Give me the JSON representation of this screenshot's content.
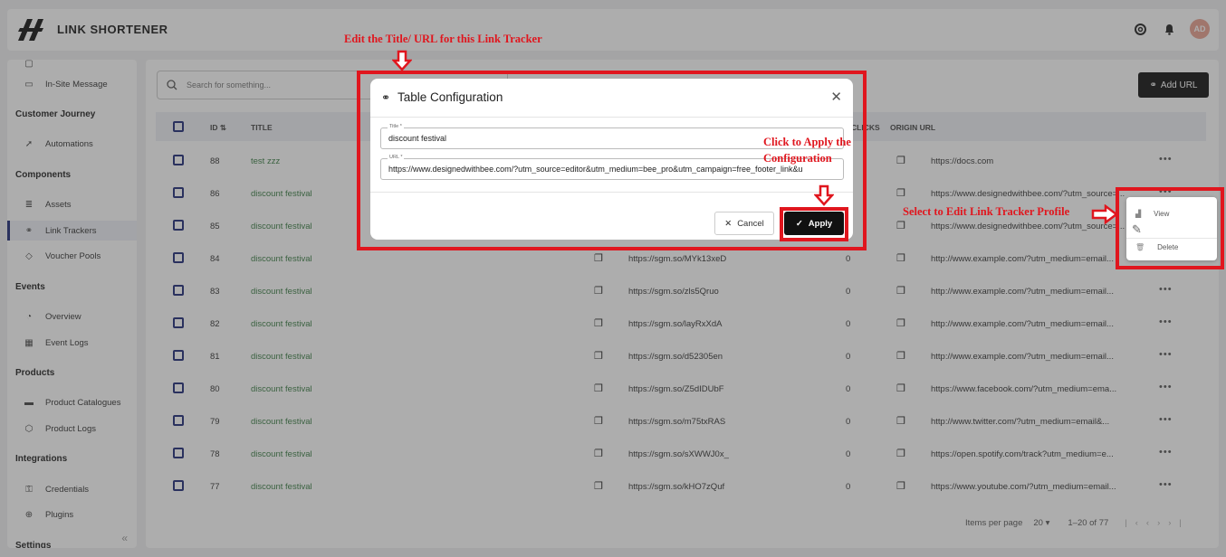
{
  "app": {
    "title": "LINK SHORTENER",
    "avatar": "AD"
  },
  "sidebar": {
    "items": [
      {
        "label": "In-Site Message",
        "icon": "message-icon"
      },
      {
        "section": "Customer Journey"
      },
      {
        "label": "Automations",
        "icon": "rocket-icon"
      },
      {
        "section": "Components"
      },
      {
        "label": "Assets",
        "icon": "database-icon"
      },
      {
        "label": "Link Trackers",
        "icon": "link-icon",
        "active": true
      },
      {
        "label": "Voucher Pools",
        "icon": "tag-icon"
      },
      {
        "section": "Events"
      },
      {
        "label": "Overview",
        "icon": "overview-icon"
      },
      {
        "label": "Event Logs",
        "icon": "calendar-icon"
      },
      {
        "section": "Products"
      },
      {
        "label": "Product Catalogues",
        "icon": "catalogue-icon"
      },
      {
        "label": "Product Logs",
        "icon": "cube-icon"
      },
      {
        "section": "Integrations"
      },
      {
        "label": "Credentials",
        "icon": "key-icon"
      },
      {
        "label": "Plugins",
        "icon": "plugin-icon"
      },
      {
        "section": "Settings"
      }
    ]
  },
  "toolbar": {
    "search_placeholder": "Search for something...",
    "add_label": "Add URL"
  },
  "table": {
    "headers": {
      "id": "ID",
      "title": "TITLE",
      "clicks": "CLICKS",
      "origin": "ORIGIN URL"
    },
    "rows": [
      {
        "id": "88",
        "title": "test zzz",
        "short": "",
        "clicks": "",
        "origin": "https://docs.com"
      },
      {
        "id": "86",
        "title": "discount festival",
        "short": "",
        "clicks": "",
        "origin": "https://www.designedwithbee.com/?utm_source=..."
      },
      {
        "id": "85",
        "title": "discount festival",
        "short": "",
        "clicks": "",
        "origin": "https://www.designedwithbee.com/?utm_source=..."
      },
      {
        "id": "84",
        "title": "discount festival",
        "short": "https://sgm.so/MYk13xeD",
        "clicks": "0",
        "origin": "http://www.example.com/?utm_medium=email..."
      },
      {
        "id": "83",
        "title": "discount festival",
        "short": "https://sgm.so/zls5Qruo",
        "clicks": "0",
        "origin": "http://www.example.com/?utm_medium=email..."
      },
      {
        "id": "82",
        "title": "discount festival",
        "short": "https://sgm.so/layRxXdA",
        "clicks": "0",
        "origin": "http://www.example.com/?utm_medium=email..."
      },
      {
        "id": "81",
        "title": "discount festival",
        "short": "https://sgm.so/d52305en",
        "clicks": "0",
        "origin": "http://www.example.com/?utm_medium=email..."
      },
      {
        "id": "80",
        "title": "discount festival",
        "short": "https://sgm.so/Z5dIDUbF",
        "clicks": "0",
        "origin": "https://www.facebook.com/?utm_medium=ema..."
      },
      {
        "id": "79",
        "title": "discount festival",
        "short": "https://sgm.so/m75txRAS",
        "clicks": "0",
        "origin": "http://www.twitter.com/?utm_medium=email&..."
      },
      {
        "id": "78",
        "title": "discount festival",
        "short": "https://sgm.so/sXWWJ0x_",
        "clicks": "0",
        "origin": "https://open.spotify.com/track?utm_medium=e..."
      },
      {
        "id": "77",
        "title": "discount festival",
        "short": "https://sgm.so/kHO7zQuf",
        "clicks": "0",
        "origin": "https://www.youtube.com/?utm_medium=email..."
      }
    ]
  },
  "pagination": {
    "items_per_page_label": "Items per page",
    "page_size": "20",
    "range": "1–20 of 77"
  },
  "modal": {
    "title": "Table Configuration",
    "title_field_label": "Title *",
    "title_value": "discount festival",
    "url_field_label": "URL *",
    "url_value": "https://www.designedwithbee.com/?utm_source=editor&utm_medium=bee_pro&utm_campaign=free_footer_link&u",
    "cancel_label": "Cancel",
    "apply_label": "Apply"
  },
  "context_menu": {
    "view_label": "View",
    "delete_label": "Delete"
  },
  "annotations": {
    "edit_note": "Edit the Title/ URL for this Link Tracker",
    "apply_note_line1": "Click to Apply the",
    "apply_note_line2": "Configuration",
    "select_note": "Select to Edit Link Tracker Profile"
  },
  "colors": {
    "highlight": "#e0161e",
    "link_green": "#3a7d44",
    "active_nav": "#1e2a78"
  }
}
